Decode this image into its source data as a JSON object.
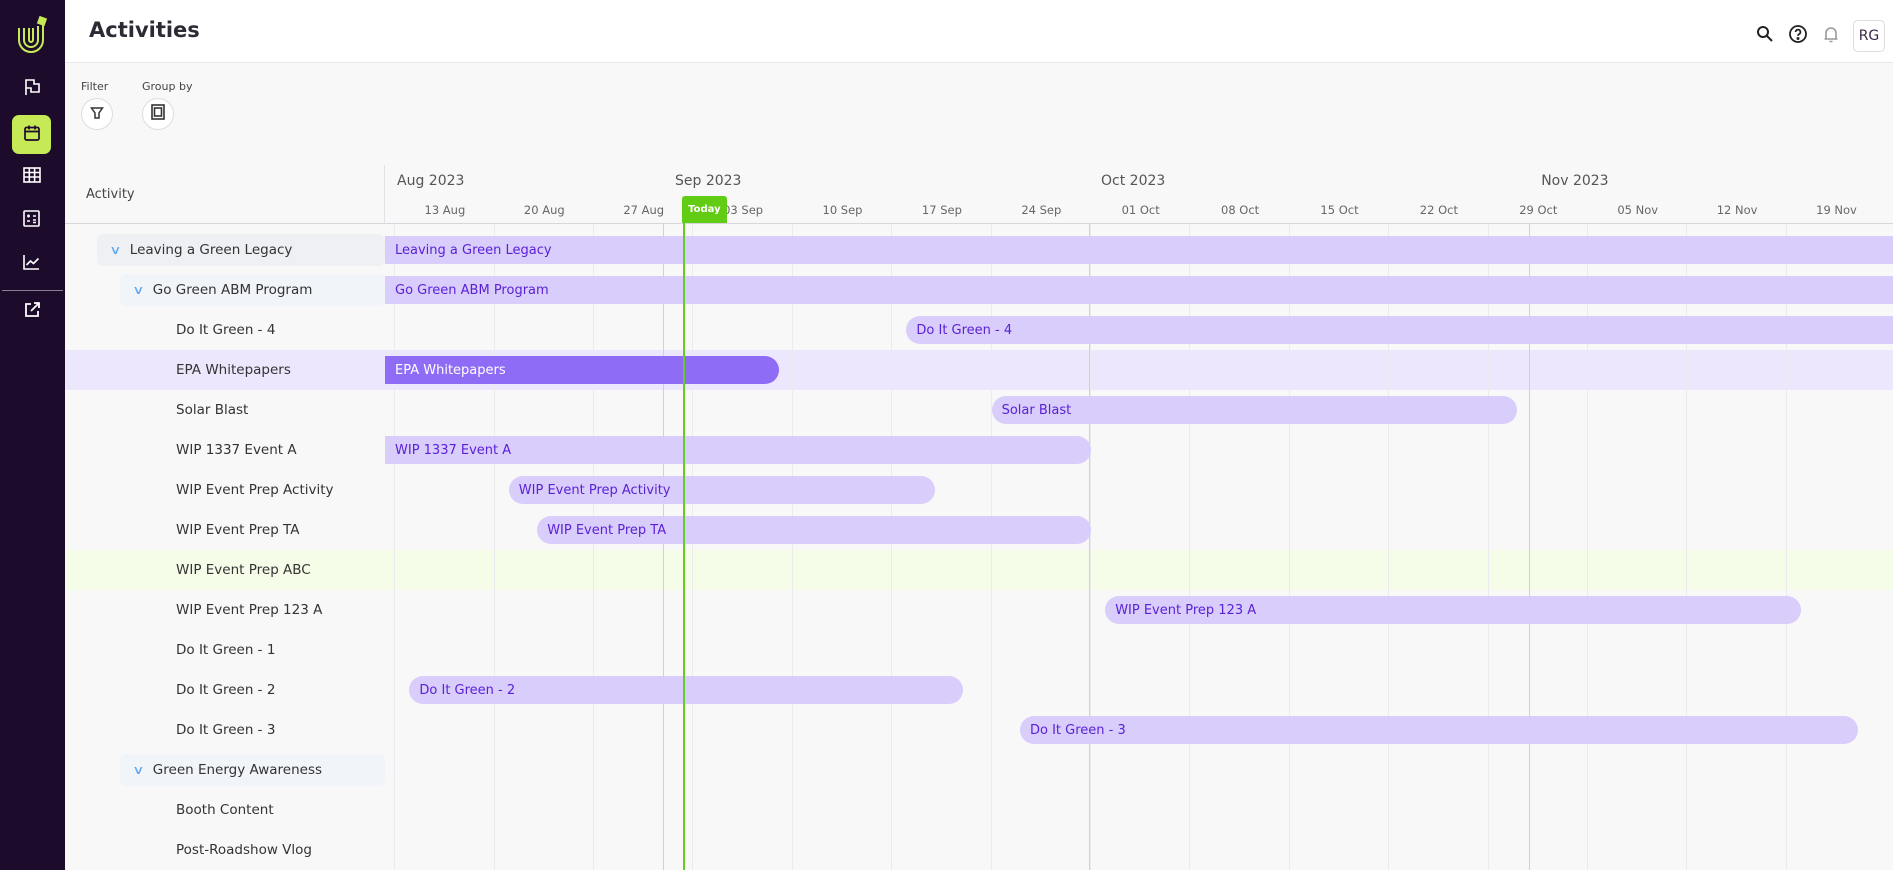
{
  "header": {
    "title": "Activities",
    "user_initials": "RG",
    "icons": [
      "search-icon",
      "help-icon",
      "bell-icon"
    ]
  },
  "sidebar": {
    "items": [
      {
        "icon": "flag-icon"
      },
      {
        "icon": "calendar-icon",
        "active": true
      },
      {
        "icon": "table-icon"
      },
      {
        "icon": "calculator-icon"
      },
      {
        "icon": "chart-icon"
      },
      {
        "icon": "external-link-icon"
      }
    ]
  },
  "toolbar": {
    "filter_label": "Filter",
    "group_by_label": "Group by"
  },
  "columns": {
    "activity": "Activity"
  },
  "colors": {
    "accent": "#c6ea55",
    "bar": "#d9cdfb",
    "bar_text": "#5b21d6",
    "bar_selected": "#8e6cf6",
    "today": "#62cc14",
    "sidebar": "#1d0b2c"
  },
  "timeline": {
    "months": [
      {
        "label": "Aug 2023",
        "date": "2023-08-01"
      },
      {
        "label": "Sep 2023",
        "date": "2023-09-01"
      },
      {
        "label": "Oct 2023",
        "date": "2023-10-01"
      },
      {
        "label": "Nov 2023",
        "date": "2023-11-01"
      }
    ],
    "weeks": [
      {
        "label": "13 Aug",
        "date": "2023-08-13"
      },
      {
        "label": "20 Aug",
        "date": "2023-08-20"
      },
      {
        "label": "27 Aug",
        "date": "2023-08-27"
      },
      {
        "label": "03 Sep",
        "date": "2023-09-03"
      },
      {
        "label": "10 Sep",
        "date": "2023-09-10"
      },
      {
        "label": "17 Sep",
        "date": "2023-09-17"
      },
      {
        "label": "24 Sep",
        "date": "2023-09-24"
      },
      {
        "label": "01 Oct",
        "date": "2023-10-01"
      },
      {
        "label": "08 Oct",
        "date": "2023-10-08"
      },
      {
        "label": "15 Oct",
        "date": "2023-10-15"
      },
      {
        "label": "22 Oct",
        "date": "2023-10-22"
      },
      {
        "label": "29 Oct",
        "date": "2023-10-29"
      },
      {
        "label": "05 Nov",
        "date": "2023-11-05"
      },
      {
        "label": "12 Nov",
        "date": "2023-11-12"
      },
      {
        "label": "19 Nov",
        "date": "2023-11-19"
      }
    ],
    "today_label": "Today",
    "today": "2023-09-02"
  },
  "activities": [
    {
      "name": "Leaving a Green Legacy",
      "level": 1,
      "group": true,
      "start": null,
      "end": null
    },
    {
      "name": "Go Green ABM Program",
      "level": 2,
      "group": true,
      "start": null,
      "end": null
    },
    {
      "name": "Do It Green - 4",
      "level": 3,
      "start": "2023-09-18",
      "end": null
    },
    {
      "name": "EPA Whitepapers",
      "level": 3,
      "start": null,
      "end": "2023-09-09",
      "selected": true
    },
    {
      "name": "Solar Blast",
      "level": 3,
      "start": "2023-09-24",
      "end": "2023-10-31"
    },
    {
      "name": "WIP 1337 Event A",
      "level": 3,
      "start": null,
      "end": "2023-10-01"
    },
    {
      "name": "WIP Event Prep Activity",
      "level": 3,
      "start": "2023-08-21",
      "end": "2023-09-20"
    },
    {
      "name": "WIP Event Prep TA",
      "level": 3,
      "start": "2023-08-23",
      "end": "2023-10-01"
    },
    {
      "name": "WIP Event Prep ABC",
      "level": 3,
      "highlighted": true
    },
    {
      "name": "WIP Event Prep 123 A",
      "level": 3,
      "start": "2023-10-02",
      "end": "2023-11-20"
    },
    {
      "name": "Do It Green - 1",
      "level": 3
    },
    {
      "name": "Do It Green - 2",
      "level": 3,
      "start": "2023-08-14",
      "end": "2023-09-22"
    },
    {
      "name": "Do It Green - 3",
      "level": 3,
      "start": "2023-09-26",
      "end": "2023-11-24"
    },
    {
      "name": "Green Energy Awareness",
      "level": 2,
      "group": true
    },
    {
      "name": "Booth Content",
      "level": 3
    },
    {
      "name": "Post-Roadshow Vlog",
      "level": 3
    }
  ]
}
